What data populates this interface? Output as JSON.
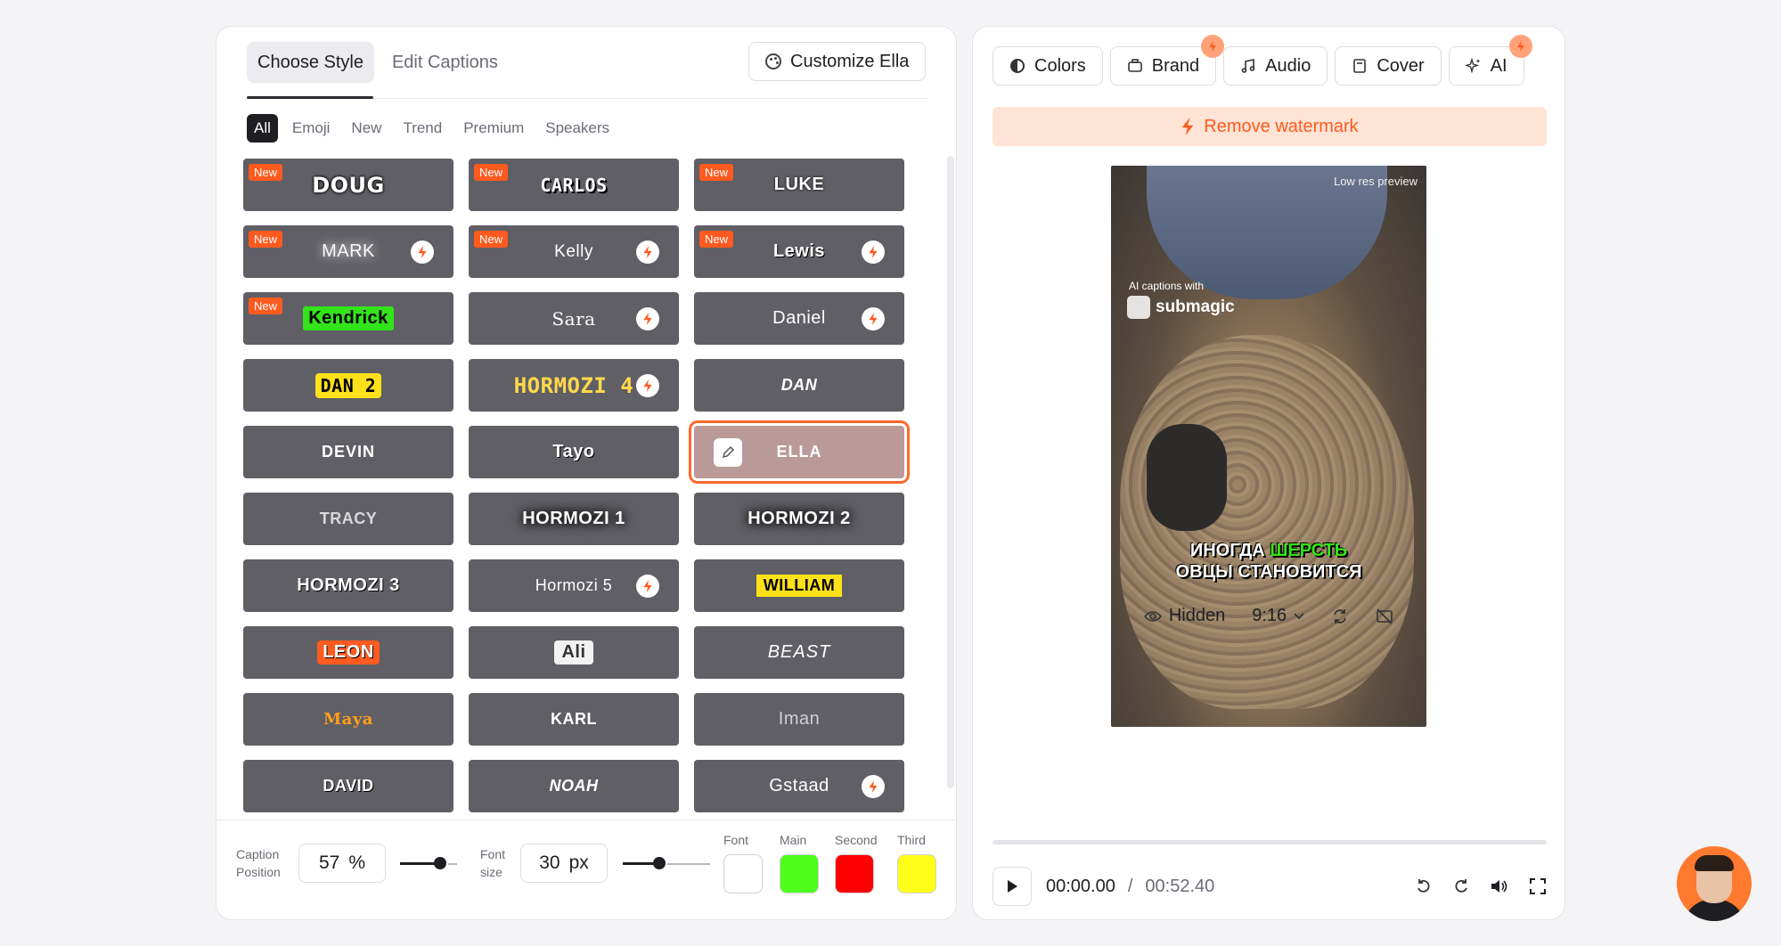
{
  "left": {
    "tabs": [
      "Choose Style",
      "Edit Captions"
    ],
    "customize_label": "Customize Ella",
    "filters": [
      "All",
      "Emoji",
      "New",
      "Trend",
      "Premium",
      "Speakers"
    ],
    "new_badge": "New",
    "styles": [
      {
        "name": "DOUG",
        "new": true,
        "premium": false
      },
      {
        "name": "CARLOS",
        "new": true,
        "premium": false
      },
      {
        "name": "LUKE",
        "new": true,
        "premium": false
      },
      {
        "name": "MARK",
        "new": true,
        "premium": true
      },
      {
        "name": "Kelly",
        "new": true,
        "premium": true
      },
      {
        "name": "Lewis",
        "new": true,
        "premium": true
      },
      {
        "name": "Kendrick",
        "new": true,
        "premium": false
      },
      {
        "name": "Sara",
        "new": false,
        "premium": true
      },
      {
        "name": "Daniel",
        "new": false,
        "premium": true
      },
      {
        "name": "DAN 2",
        "new": false,
        "premium": false
      },
      {
        "name": "HORMOZI 4",
        "new": false,
        "premium": true
      },
      {
        "name": "DAN",
        "new": false,
        "premium": false
      },
      {
        "name": "DEVIN",
        "new": false,
        "premium": false
      },
      {
        "name": "Tayo",
        "new": false,
        "premium": false
      },
      {
        "name": "ELLA",
        "new": false,
        "premium": false,
        "selected": true
      },
      {
        "name": "TRACY",
        "new": false,
        "premium": false
      },
      {
        "name": "HORMOZI 1",
        "new": false,
        "premium": false
      },
      {
        "name": "HORMOZI 2",
        "new": false,
        "premium": false
      },
      {
        "name": "HORMOZI 3",
        "new": false,
        "premium": false
      },
      {
        "name": "Hormozi 5",
        "new": false,
        "premium": true
      },
      {
        "name": "WILLIAM",
        "new": false,
        "premium": false
      },
      {
        "name": "LEON",
        "new": false,
        "premium": false
      },
      {
        "name": "Ali",
        "new": false,
        "premium": false
      },
      {
        "name": "BEAST",
        "new": false,
        "premium": false
      },
      {
        "name": "Maya",
        "new": false,
        "premium": false
      },
      {
        "name": "KARL",
        "new": false,
        "premium": false
      },
      {
        "name": "Iman",
        "new": false,
        "premium": false
      },
      {
        "name": "DAVID",
        "new": false,
        "premium": false
      },
      {
        "name": "NOAH",
        "new": false,
        "premium": false
      },
      {
        "name": "Gstaad",
        "new": false,
        "premium": true
      }
    ],
    "controls": {
      "caption_position_label_1": "Caption",
      "caption_position_label_2": "Position",
      "caption_position_value": "57",
      "caption_position_unit": "%",
      "font_size_label_1": "Font",
      "font_size_label_2": "size",
      "font_size_value": "30",
      "font_size_unit": "px",
      "swatches": [
        {
          "label": "Font",
          "color": "#ffffff"
        },
        {
          "label": "Main",
          "color": "#4dff1a"
        },
        {
          "label": "Second",
          "color": "#ff0000"
        },
        {
          "label": "Third",
          "color": "#ffff1a"
        }
      ]
    }
  },
  "right": {
    "tabs": [
      {
        "label": "Colors",
        "icon": "contrast-icon",
        "bolt": false
      },
      {
        "label": "Brand",
        "icon": "briefcase-icon",
        "bolt": true
      },
      {
        "label": "Audio",
        "icon": "music-icon",
        "bolt": false
      },
      {
        "label": "Cover",
        "icon": "book-icon",
        "bolt": false
      },
      {
        "label": "AI",
        "icon": "sparkles-icon",
        "bolt": true
      }
    ],
    "watermark_label": "Remove watermark",
    "video": {
      "low_res": "Low res preview",
      "ai_captions": "AI captions with",
      "brand": "submagic",
      "caption_line1_a": "ИНОГДА",
      "caption_line1_b": "ШЕРСТЬ",
      "caption_line2": "ОВЦЫ СТАНОВИТСЯ"
    },
    "video_controls": {
      "visibility": "Hidden",
      "ratio": "9:16"
    },
    "player": {
      "current": "00:00.00",
      "separator": "/",
      "total": "00:52.40"
    }
  },
  "colors": {
    "accent": "#ff5a1f",
    "card": "#5f5f65",
    "selected_card": "#b99a98"
  }
}
